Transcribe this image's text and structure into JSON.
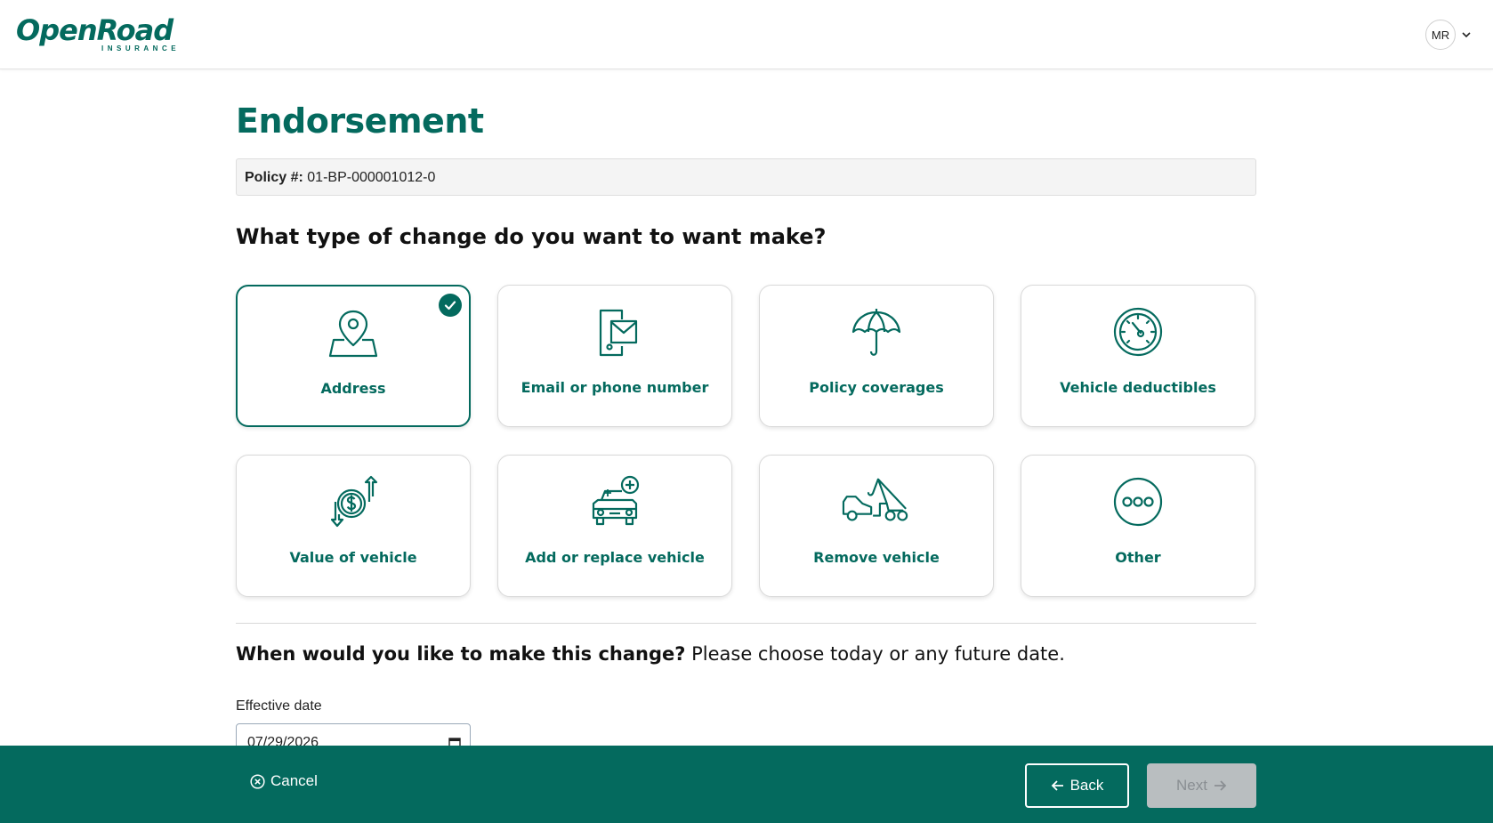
{
  "header": {
    "logo_text": "OpenRoad",
    "logo_subtext": "INSURANCE",
    "user_initials": "MR"
  },
  "page": {
    "title": "Endorsement",
    "policy_label": "Policy #:",
    "policy_number": "01-BP-000001012-0",
    "question": "What type of change do you want to want make?"
  },
  "change_types": [
    {
      "label": "Address",
      "icon": "map-pin-icon",
      "selected": true
    },
    {
      "label": "Email or phone number",
      "icon": "phone-email-icon",
      "selected": false
    },
    {
      "label": "Policy coverages",
      "icon": "umbrella-icon",
      "selected": false
    },
    {
      "label": "Vehicle deductibles",
      "icon": "gauge-icon",
      "selected": false
    },
    {
      "label": "Value of vehicle",
      "icon": "dollar-arrows-icon",
      "selected": false
    },
    {
      "label": "Add or replace vehicle",
      "icon": "car-add-icon",
      "selected": false
    },
    {
      "label": "Remove vehicle",
      "icon": "tow-truck-icon",
      "selected": false
    },
    {
      "label": "Other",
      "icon": "more-dots-icon",
      "selected": false
    }
  ],
  "effective": {
    "question_bold": "When would you like to make this change?",
    "question_rest": " Please choose today or any future date.",
    "label": "Effective date",
    "value": "07/29/2026"
  },
  "footer": {
    "cancel_label": "Cancel",
    "back_label": "Back",
    "next_label": "Next"
  },
  "colors": {
    "brand": "#046a5e",
    "disabled_button": "#b9bec0"
  }
}
